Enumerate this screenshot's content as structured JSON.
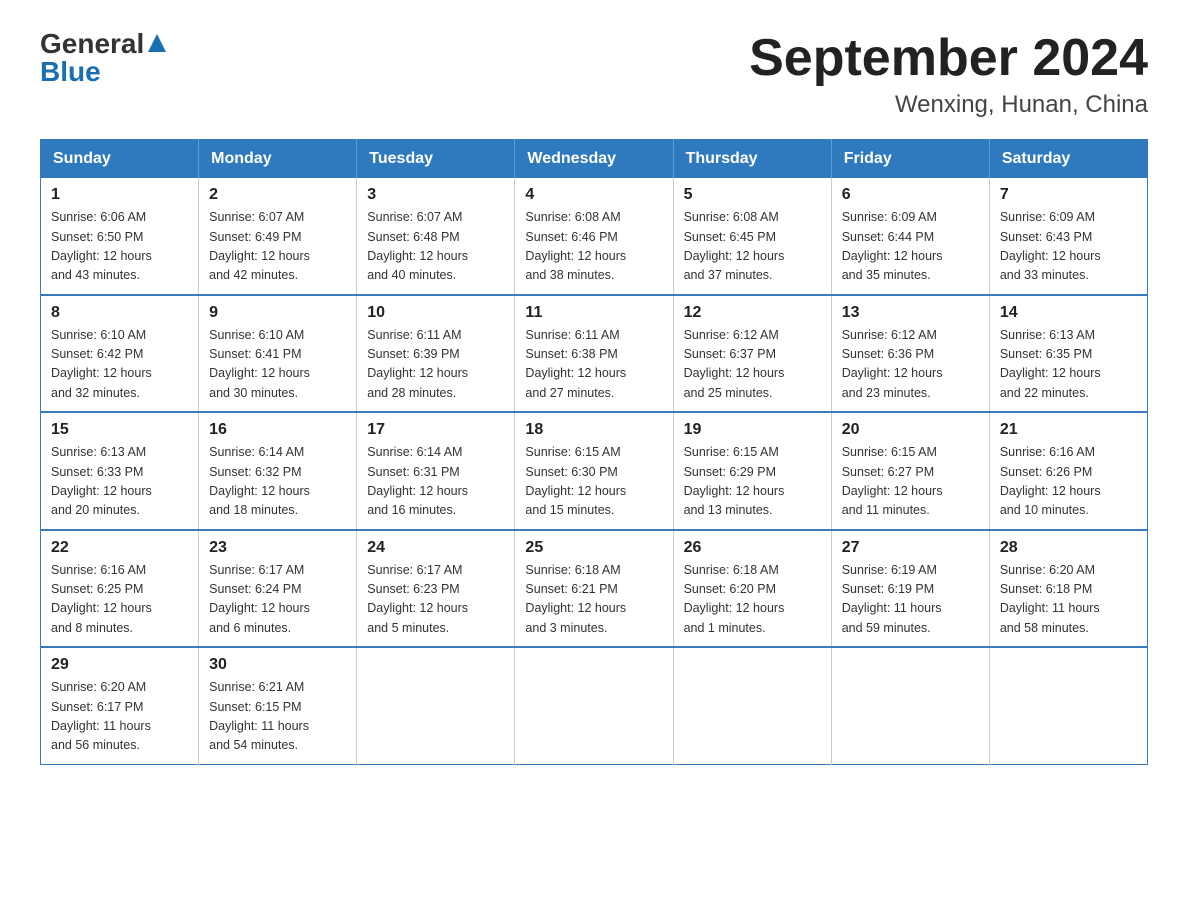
{
  "logo": {
    "general": "General",
    "blue": "Blue"
  },
  "title": {
    "month_year": "September 2024",
    "location": "Wenxing, Hunan, China"
  },
  "weekdays": [
    "Sunday",
    "Monday",
    "Tuesday",
    "Wednesday",
    "Thursday",
    "Friday",
    "Saturday"
  ],
  "weeks": [
    [
      {
        "day": "1",
        "sunrise": "6:06 AM",
        "sunset": "6:50 PM",
        "daylight": "12 hours and 43 minutes."
      },
      {
        "day": "2",
        "sunrise": "6:07 AM",
        "sunset": "6:49 PM",
        "daylight": "12 hours and 42 minutes."
      },
      {
        "day": "3",
        "sunrise": "6:07 AM",
        "sunset": "6:48 PM",
        "daylight": "12 hours and 40 minutes."
      },
      {
        "day": "4",
        "sunrise": "6:08 AM",
        "sunset": "6:46 PM",
        "daylight": "12 hours and 38 minutes."
      },
      {
        "day": "5",
        "sunrise": "6:08 AM",
        "sunset": "6:45 PM",
        "daylight": "12 hours and 37 minutes."
      },
      {
        "day": "6",
        "sunrise": "6:09 AM",
        "sunset": "6:44 PM",
        "daylight": "12 hours and 35 minutes."
      },
      {
        "day": "7",
        "sunrise": "6:09 AM",
        "sunset": "6:43 PM",
        "daylight": "12 hours and 33 minutes."
      }
    ],
    [
      {
        "day": "8",
        "sunrise": "6:10 AM",
        "sunset": "6:42 PM",
        "daylight": "12 hours and 32 minutes."
      },
      {
        "day": "9",
        "sunrise": "6:10 AM",
        "sunset": "6:41 PM",
        "daylight": "12 hours and 30 minutes."
      },
      {
        "day": "10",
        "sunrise": "6:11 AM",
        "sunset": "6:39 PM",
        "daylight": "12 hours and 28 minutes."
      },
      {
        "day": "11",
        "sunrise": "6:11 AM",
        "sunset": "6:38 PM",
        "daylight": "12 hours and 27 minutes."
      },
      {
        "day": "12",
        "sunrise": "6:12 AM",
        "sunset": "6:37 PM",
        "daylight": "12 hours and 25 minutes."
      },
      {
        "day": "13",
        "sunrise": "6:12 AM",
        "sunset": "6:36 PM",
        "daylight": "12 hours and 23 minutes."
      },
      {
        "day": "14",
        "sunrise": "6:13 AM",
        "sunset": "6:35 PM",
        "daylight": "12 hours and 22 minutes."
      }
    ],
    [
      {
        "day": "15",
        "sunrise": "6:13 AM",
        "sunset": "6:33 PM",
        "daylight": "12 hours and 20 minutes."
      },
      {
        "day": "16",
        "sunrise": "6:14 AM",
        "sunset": "6:32 PM",
        "daylight": "12 hours and 18 minutes."
      },
      {
        "day": "17",
        "sunrise": "6:14 AM",
        "sunset": "6:31 PM",
        "daylight": "12 hours and 16 minutes."
      },
      {
        "day": "18",
        "sunrise": "6:15 AM",
        "sunset": "6:30 PM",
        "daylight": "12 hours and 15 minutes."
      },
      {
        "day": "19",
        "sunrise": "6:15 AM",
        "sunset": "6:29 PM",
        "daylight": "12 hours and 13 minutes."
      },
      {
        "day": "20",
        "sunrise": "6:15 AM",
        "sunset": "6:27 PM",
        "daylight": "12 hours and 11 minutes."
      },
      {
        "day": "21",
        "sunrise": "6:16 AM",
        "sunset": "6:26 PM",
        "daylight": "12 hours and 10 minutes."
      }
    ],
    [
      {
        "day": "22",
        "sunrise": "6:16 AM",
        "sunset": "6:25 PM",
        "daylight": "12 hours and 8 minutes."
      },
      {
        "day": "23",
        "sunrise": "6:17 AM",
        "sunset": "6:24 PM",
        "daylight": "12 hours and 6 minutes."
      },
      {
        "day": "24",
        "sunrise": "6:17 AM",
        "sunset": "6:23 PM",
        "daylight": "12 hours and 5 minutes."
      },
      {
        "day": "25",
        "sunrise": "6:18 AM",
        "sunset": "6:21 PM",
        "daylight": "12 hours and 3 minutes."
      },
      {
        "day": "26",
        "sunrise": "6:18 AM",
        "sunset": "6:20 PM",
        "daylight": "12 hours and 1 minute."
      },
      {
        "day": "27",
        "sunrise": "6:19 AM",
        "sunset": "6:19 PM",
        "daylight": "11 hours and 59 minutes."
      },
      {
        "day": "28",
        "sunrise": "6:20 AM",
        "sunset": "6:18 PM",
        "daylight": "11 hours and 58 minutes."
      }
    ],
    [
      {
        "day": "29",
        "sunrise": "6:20 AM",
        "sunset": "6:17 PM",
        "daylight": "11 hours and 56 minutes."
      },
      {
        "day": "30",
        "sunrise": "6:21 AM",
        "sunset": "6:15 PM",
        "daylight": "11 hours and 54 minutes."
      },
      null,
      null,
      null,
      null,
      null
    ]
  ],
  "labels": {
    "sunrise": "Sunrise:",
    "sunset": "Sunset:",
    "daylight": "Daylight:"
  }
}
